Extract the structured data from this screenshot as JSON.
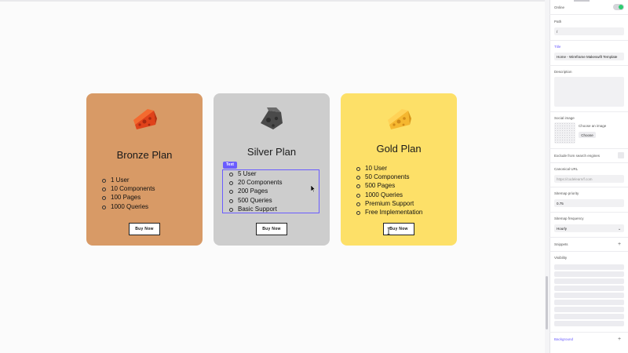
{
  "cards": [
    {
      "title": "Bronze Plan",
      "features": [
        "1 User",
        "10 Components",
        "100 Pages",
        "1000 Queries"
      ],
      "button": "Buy Now",
      "color": "#d89a66"
    },
    {
      "title": "Silver Plan",
      "features": [
        "5 User",
        "20 Components",
        "200 Pages",
        "500 Queries",
        "Basic Support"
      ],
      "button": "Buy Now",
      "color": "#cdcdcd"
    },
    {
      "title": "Gold Plan",
      "features": [
        "10 User",
        "50 Components",
        "500 Pages",
        "1000 Queries",
        "Premium Support",
        "Free Implementation"
      ],
      "button": "Buy Now",
      "color": "#fde068"
    }
  ],
  "selection_tag": "Text",
  "panel": {
    "online_label": "Online",
    "online_enabled": true,
    "path_label": "Path",
    "path_value": "/",
    "title_label": "Title",
    "title_value": "Home - Wireframe Makeswift Template",
    "description_label": "Description",
    "description_value": "",
    "social_image_label": "Social image",
    "choose_image_text": "Choose an image",
    "choose_button": "Choose",
    "exclude_label": "Exclude from search engines",
    "canonical_label": "Canonical URL",
    "canonical_placeholder": "https://codelearn/f.com",
    "priority_label": "Sitemap priority",
    "priority_value": "0.75",
    "frequency_label": "Sitemap frequency",
    "frequency_value": "Hourly",
    "snippets_label": "Snippets",
    "visibility_label": "Visibility",
    "background_label": "Background"
  },
  "colors": {
    "accent": "#6a5cff",
    "toggle_on": "#2ecc71"
  },
  "icons": [
    "bronze-cheese-icon",
    "silver-cheese-icon",
    "gold-cheese-icon",
    "plus-icon",
    "chevron-down-icon",
    "pointer-cursor-icon",
    "text-cursor-icon"
  ]
}
